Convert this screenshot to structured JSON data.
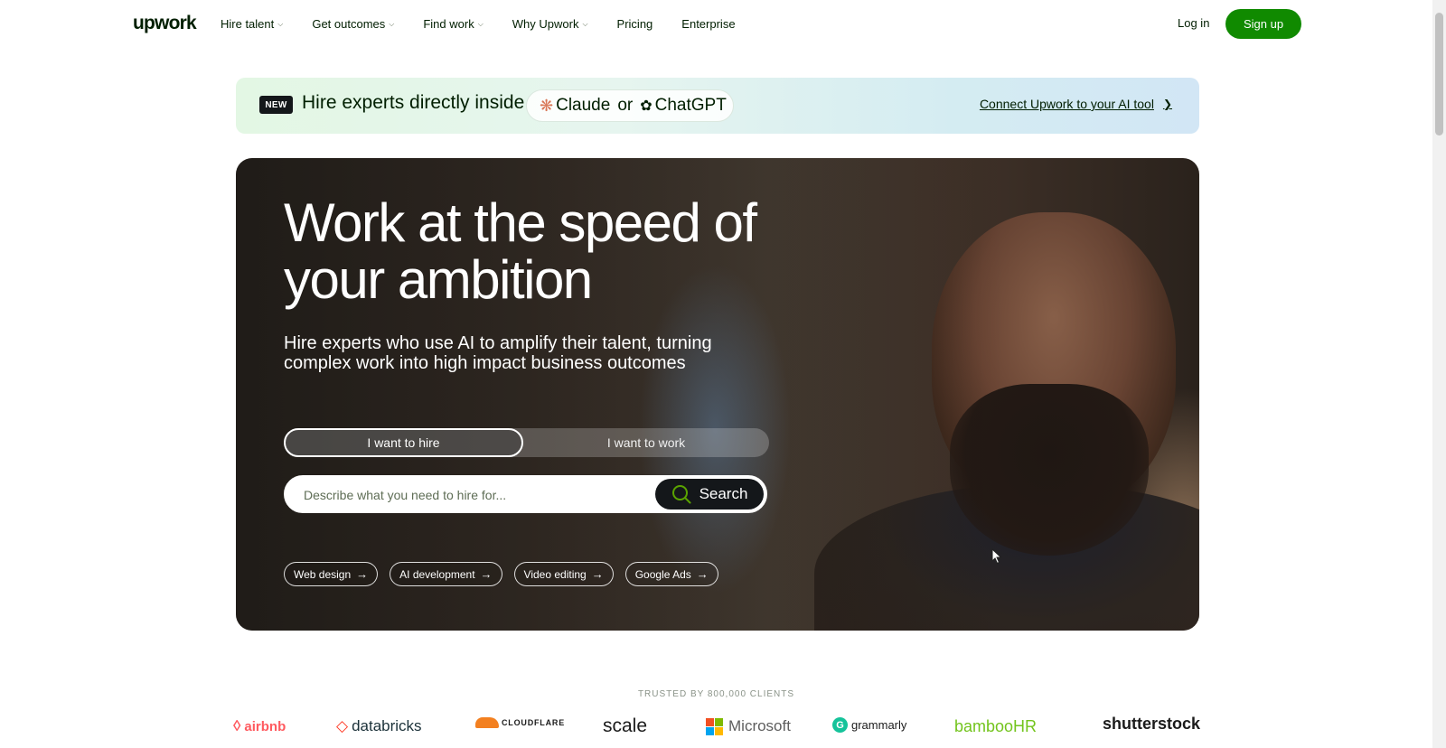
{
  "header": {
    "logo": "upwork",
    "nav": [
      {
        "label": "Hire talent",
        "dropdown": true
      },
      {
        "label": "Get outcomes",
        "dropdown": true
      },
      {
        "label": "Find work",
        "dropdown": true
      },
      {
        "label": "Why Upwork",
        "dropdown": true
      },
      {
        "label": "Pricing",
        "dropdown": false
      },
      {
        "label": "Enterprise",
        "dropdown": false
      }
    ],
    "login": "Log in",
    "signup": "Sign up"
  },
  "banner": {
    "badge": "NEW",
    "text": "Hire experts directly inside",
    "tool1": "Claude",
    "or": "or",
    "tool2": "ChatGPT",
    "link": "Connect Upwork to your AI tool"
  },
  "hero": {
    "title": "Work at the speed of your ambition",
    "subtitle": "Hire experts who use AI to amplify their talent, turning complex work into high impact business outcomes",
    "toggle_hire": "I want to hire",
    "toggle_work": "I want to work",
    "search_placeholder": "Describe what you need to hire for...",
    "search_button": "Search",
    "chips": [
      "Web design",
      "AI development",
      "Video editing",
      "Google Ads"
    ]
  },
  "trusted": {
    "label": "TRUSTED BY 800,000 CLIENTS",
    "logos": [
      "airbnb",
      "databricks",
      "CLOUDFLARE",
      "scale",
      "Microsoft",
      "grammarly",
      "bambooHR",
      "shutterstock"
    ]
  },
  "colors": {
    "brand_green": "#108a00",
    "text_dark": "#001e00",
    "search_button": "#14171a"
  }
}
